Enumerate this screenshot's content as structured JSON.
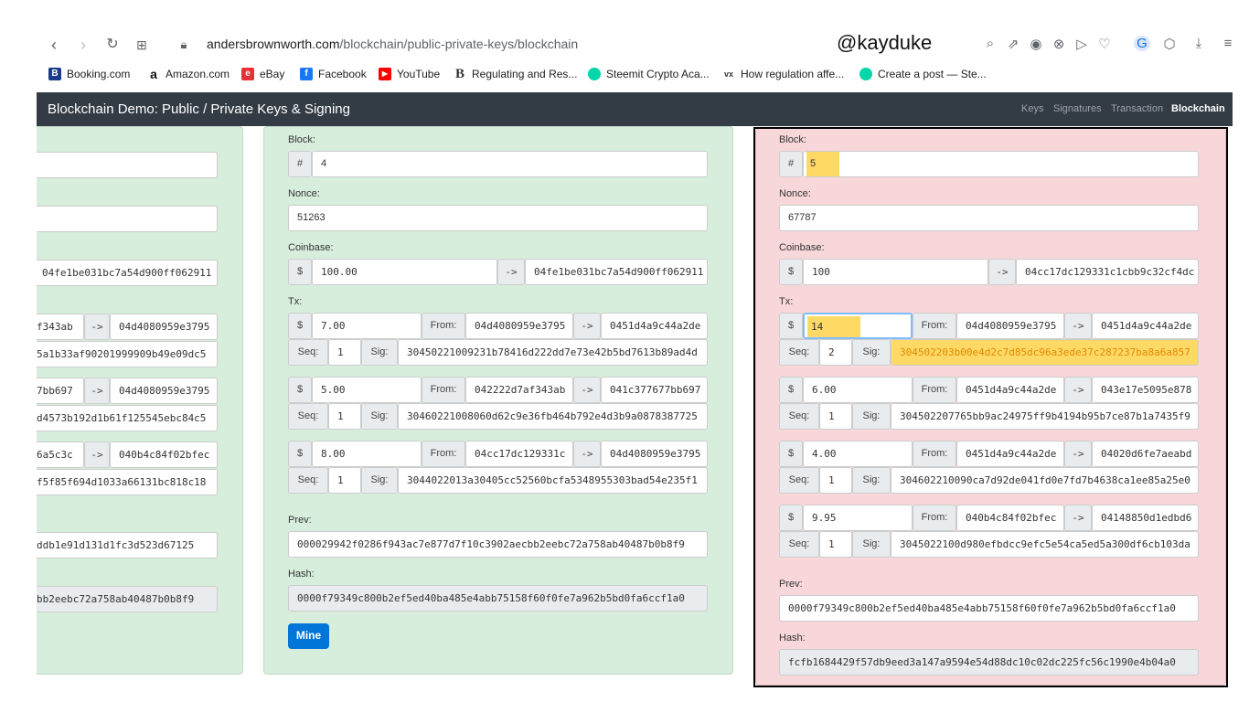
{
  "browser": {
    "url_host": "andersbrownworth.com",
    "url_path": "/blockchain/public-private-keys/blockchain",
    "watermark": "@kayduke",
    "bookmarks": [
      "Booking.com",
      "Amazon.com",
      "eBay",
      "Facebook",
      "YouTube",
      "Regulating and Res...",
      "Steemit Crypto Aca...",
      "How regulation affe...",
      "Create a post — Ste..."
    ]
  },
  "app": {
    "title": "Blockchain Demo: Public / Private Keys & Signing",
    "nav": [
      "Keys",
      "Signatures",
      "Transaction",
      "Blockchain"
    ]
  },
  "labels": {
    "block": "Block:",
    "nonce": "Nonce:",
    "coinbase": "Coinbase:",
    "tx": "Tx:",
    "prev": "Prev:",
    "hash": "Hash:",
    "hash_sym": "#",
    "dollar": "$",
    "arrow": "->",
    "from": "From:",
    "seq": "Seq:",
    "sig": "Sig:",
    "mine": "Mine"
  },
  "block3_partial": {
    "coinbase_to": "04fe1be031bc7a54d900ff062911",
    "tx": [
      {
        "from_tail": "f343ab",
        "to": "04d4080959e3795",
        "sig": "5a1b33af90201999909b49e09dc5"
      },
      {
        "from_tail": "7bb697",
        "to": "04d4080959e3795",
        "sig": "d4573b192d1b61f125545ebc84c5"
      },
      {
        "from_tail": "6a5c3c",
        "to": "040b4c84f02bfec",
        "sig": "f5f85f694d1033a66131bc818c18"
      }
    ],
    "prev": "ddb1e91d131d1fc3d523d67125",
    "hash": "bb2eebc72a758ab40487b0b8f9"
  },
  "block4": {
    "number": "4",
    "nonce": "51263",
    "coinbase_amount": "100.00",
    "coinbase_to": "04fe1be031bc7a54d900ff062911",
    "tx": [
      {
        "amount": "7.00",
        "from": "04d4080959e3795",
        "to": "0451d4a9c44a2de",
        "seq": "1",
        "sig": "30450221009231b78416d222dd7e73e42b5bd7613b89ad4d"
      },
      {
        "amount": "5.00",
        "from": "042222d7af343ab",
        "to": "041c377677bb697",
        "seq": "1",
        "sig": "30460221008060d62c9e36fb464b792e4d3b9a0878387725"
      },
      {
        "amount": "8.00",
        "from": "04cc17dc129331c",
        "to": "04d4080959e3795",
        "seq": "1",
        "sig": "3044022013a30405cc52560bcfa5348955303bad54e235f1"
      }
    ],
    "prev": "000029942f0286f943ac7e877d7f10c3902aecbb2eebc72a758ab40487b0b8f9",
    "hash": "0000f79349c800b2ef5ed40ba485e4abb75158f60f0fe7a962b5bd0fa6ccf1a0"
  },
  "block5": {
    "number": "5",
    "nonce": "67787",
    "coinbase_amount": "100",
    "coinbase_to": "04cc17dc129331c1cbb9c32cf4dc",
    "tx": [
      {
        "amount": "14",
        "from": "04d4080959e3795",
        "to": "0451d4a9c44a2de",
        "seq": "2",
        "sig": "304502203b00e4d2c7d85dc96a3ede37c287237ba8a6a857"
      },
      {
        "amount": "6.00",
        "from": "0451d4a9c44a2de",
        "to": "043e17e5095e878",
        "seq": "1",
        "sig": "304502207765bb9ac24975ff9b4194b95b7ce87b1a7435f9"
      },
      {
        "amount": "4.00",
        "from": "0451d4a9c44a2de",
        "to": "04020d6fe7aeabd",
        "seq": "1",
        "sig": "304602210090ca7d92de041fd0e7fd7b4638ca1ee85a25e0"
      },
      {
        "amount": "9.95",
        "from": "040b4c84f02bfec",
        "to": "04148850d1edbd6",
        "seq": "1",
        "sig": "3045022100d980efbdcc9efc5e54ca5ed5a300df6cb103da"
      }
    ],
    "prev": "0000f79349c800b2ef5ed40ba485e4abb75158f60f0fe7a962b5bd0fa6ccf1a0",
    "hash": "fcfb1684429f57db9eed3a147a9594e54d88dc10c02dc225fc56c1990e4b04a0"
  },
  "colors": {
    "green_block": "#d7eedc",
    "red_block": "#f7d7d9",
    "highlight": "#ffd966",
    "navbar": "#333b45",
    "mine_button": "#0275d8"
  }
}
